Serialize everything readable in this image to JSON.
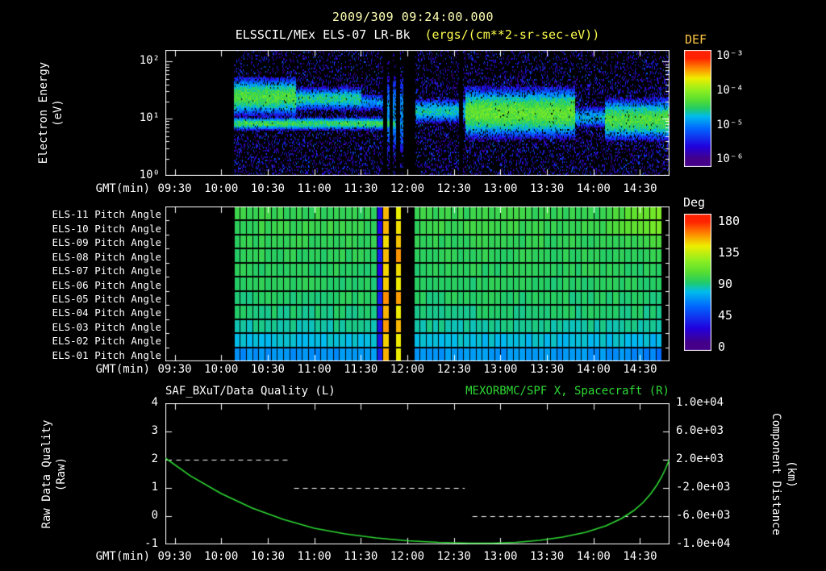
{
  "header": {
    "title": "2009/309 09:24:00.000",
    "instrument": "ELSSCIL/MEx ELS-07 LR-Bk",
    "units": "(ergs/(cm**2-sr-sec-eV))"
  },
  "colors": {
    "background": "#000000",
    "title": "#ffffb4",
    "instrument": "#ffffff",
    "units": "#ffff4d",
    "def_title": "#ffc845",
    "deg_title": "#ffffff",
    "axis": "#ffffff",
    "quality_line": "#ffffff",
    "distance_line": "#2ed934",
    "rainbow": [
      [
        0,
        "#440088"
      ],
      [
        0.12,
        "#2200dd"
      ],
      [
        0.3,
        "#0066ff"
      ],
      [
        0.42,
        "#00bbee"
      ],
      [
        0.5,
        "#22cc66"
      ],
      [
        0.58,
        "#55dd33"
      ],
      [
        0.67,
        "#88ee22"
      ],
      [
        0.8,
        "#eeee00"
      ],
      [
        0.9,
        "#ff8800"
      ],
      [
        1,
        "#ff2200"
      ]
    ]
  },
  "time_axis": {
    "label": "GMT(min)",
    "start_minute": 564,
    "end_minute": 889,
    "tick_minutes": [
      570,
      600,
      630,
      660,
      690,
      720,
      750,
      780,
      810,
      840,
      870
    ],
    "tick_labels": [
      "09:30",
      "10:00",
      "10:30",
      "11:00",
      "11:30",
      "12:00",
      "12:30",
      "13:00",
      "13:30",
      "14:00",
      "14:30"
    ]
  },
  "chart_data": [
    {
      "type": "heatmap",
      "name": "electron-energy-spectrogram",
      "ylabel_line1": "Electron Energy",
      "ylabel_line2": "(eV)",
      "yscale": "log",
      "ylim_ev": [
        1,
        160
      ],
      "yticks": [
        {
          "value": 100,
          "label": "10²"
        },
        {
          "value": 10,
          "label": "10¹"
        },
        {
          "value": 1,
          "label": "10⁰"
        }
      ],
      "colorbar": {
        "title": "DEF",
        "tick_labels": [
          "10⁻³",
          "10⁻⁴",
          "10⁻⁵",
          "10⁻⁶"
        ],
        "log10_range": [
          -3,
          -6
        ]
      },
      "data_start_minute": 608,
      "data_end_minute": 888,
      "gap_minutes": [
        [
          704,
          706.5
        ],
        [
          708.5,
          710.5
        ],
        [
          712.5,
          715
        ],
        [
          717,
          725
        ],
        [
          753,
          755.5
        ]
      ],
      "bands": [
        {
          "t0": 608,
          "t1": 648,
          "center_ev": 25,
          "width_dex": 0.2,
          "peak_log10_def": -4.3
        },
        {
          "t0": 648,
          "t1": 690,
          "center_ev": 23,
          "width_dex": 0.13,
          "peak_log10_def": -4.55
        },
        {
          "t0": 690,
          "t1": 706,
          "center_ev": 20,
          "width_dex": 0.1,
          "peak_log10_def": -4.9
        },
        {
          "t0": 608,
          "t1": 712,
          "center_ev": 8.5,
          "width_dex": 0.07,
          "peak_log10_def": -4.4
        },
        {
          "t0": 706,
          "t1": 725,
          "center_ev": 12,
          "width_dex": 0.5,
          "peak_log10_def": -4.9
        },
        {
          "t0": 725,
          "t1": 757,
          "center_ev": 14,
          "width_dex": 0.14,
          "peak_log10_def": -4.65
        },
        {
          "t0": 757,
          "t1": 828,
          "center_ev": 13,
          "width_dex": 0.26,
          "peak_log10_def": -4.2
        },
        {
          "t0": 828,
          "t1": 847,
          "center_ev": 11,
          "width_dex": 0.13,
          "peak_log10_def": -4.8
        },
        {
          "t0": 847,
          "t1": 888,
          "center_ev": 10,
          "width_dex": 0.22,
          "peak_log10_def": -4.3
        }
      ]
    },
    {
      "type": "heatmap",
      "name": "pitch-angle-panels",
      "rows": [
        "ELS-11 Pitch Angle",
        "ELS-10 Pitch Angle",
        "ELS-09 Pitch Angle",
        "ELS-08 Pitch Angle",
        "ELS-07 Pitch Angle",
        "ELS-06 Pitch Angle",
        "ELS-05 Pitch Angle",
        "ELS-04 Pitch Angle",
        "ELS-03 Pitch Angle",
        "ELS-02 Pitch Angle",
        "ELS-01 Pitch Angle"
      ],
      "colorbar": {
        "title": "Deg",
        "tick_labels": [
          "180",
          "135",
          "90",
          "45",
          "0"
        ],
        "range_deg": [
          0,
          180
        ]
      },
      "data_start_minute": 608,
      "data_end_minute": 884,
      "bin_minutes": 4,
      "row_mean_deg": [
        96,
        96,
        94,
        93,
        92,
        91,
        90,
        88,
        84,
        77,
        66
      ],
      "events": [
        {
          "t0": 700,
          "t1": 704,
          "type": "cold"
        },
        {
          "t0": 704,
          "t1": 708,
          "type": "hot"
        },
        {
          "t0": 708,
          "t1": 712,
          "type": "gap"
        },
        {
          "t0": 712,
          "t1": 716,
          "type": "hot"
        },
        {
          "t0": 716,
          "t1": 724,
          "type": "gap"
        }
      ]
    },
    {
      "type": "line",
      "name": "quality-and-distance",
      "title_left": "SAF_BXuT/Data Quality (L)",
      "title_right": "MEXORBMC/SPF X, Spacecraft (R)",
      "left_label_line1": "Raw Data Quality",
      "left_label_line2": "(Raw)",
      "right_label_line1": "Component Distance",
      "right_label_line2": "(km)",
      "left_axis": {
        "range": [
          -1,
          4
        ],
        "ticks": [
          4,
          3,
          2,
          1,
          0,
          -1
        ]
      },
      "right_axis": {
        "range": [
          -10000,
          10000
        ],
        "tick_labels": [
          "1.0e+04",
          "6.0e+03",
          "2.0e+03",
          "-2.0e+03",
          "-6.0e+03",
          "-1.0e+04"
        ]
      },
      "quality_segments": [
        {
          "value": 2,
          "start_minute": 571,
          "end_minute": 643
        },
        {
          "value": 1,
          "start_minute": 647,
          "end_minute": 757
        },
        {
          "value": 0,
          "start_minute": 762,
          "end_minute": 884
        }
      ],
      "distance_points_minute_km": [
        [
          564,
          2240
        ],
        [
          580,
          -280
        ],
        [
          600,
          -2800
        ],
        [
          620,
          -4850
        ],
        [
          640,
          -6450
        ],
        [
          660,
          -7710
        ],
        [
          680,
          -8510
        ],
        [
          700,
          -9080
        ],
        [
          720,
          -9490
        ],
        [
          740,
          -9710
        ],
        [
          760,
          -9830
        ],
        [
          775,
          -9830
        ],
        [
          790,
          -9710
        ],
        [
          805,
          -9430
        ],
        [
          820,
          -8970
        ],
        [
          835,
          -8290
        ],
        [
          848,
          -7370
        ],
        [
          858,
          -6340
        ],
        [
          866,
          -5200
        ],
        [
          872,
          -4060
        ],
        [
          877,
          -2800
        ],
        [
          881,
          -1540
        ],
        [
          884,
          -400
        ],
        [
          886,
          510
        ],
        [
          888,
          1540
        ],
        [
          889,
          2000
        ]
      ]
    }
  ]
}
